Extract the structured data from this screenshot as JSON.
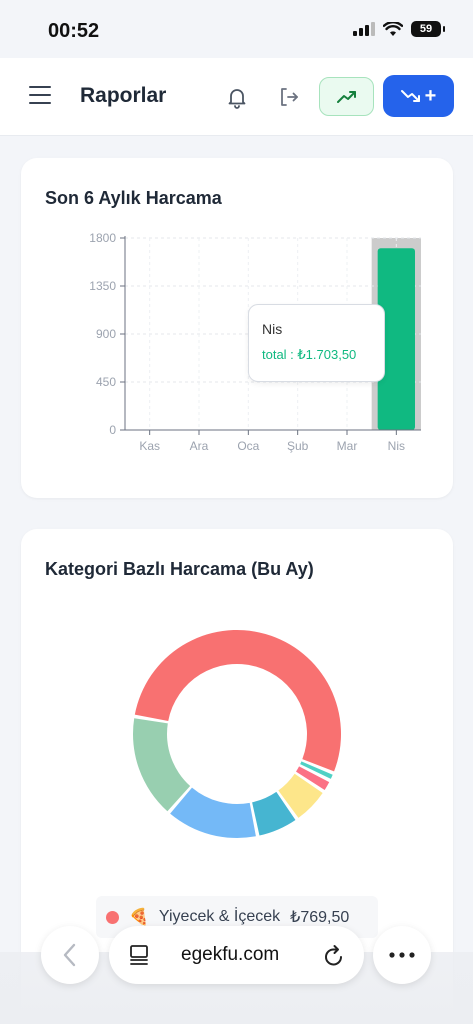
{
  "status_bar": {
    "time": "00:52",
    "battery": "59"
  },
  "header": {
    "title": "Raporlar"
  },
  "monthly_card": {
    "title": "Son 6 Aylık Harcama"
  },
  "tooltip": {
    "title": "Nis",
    "label": "total : ₺1.703,50"
  },
  "category_card": {
    "title": "Kategori Bazlı Harcama (Bu Ay)"
  },
  "legend": {
    "emoji": "🍕",
    "name": "Yiyecek & İçecek",
    "amount": "₺769,50",
    "color": "#f87171"
  },
  "browser": {
    "url": "egekfu.com"
  },
  "colors": {
    "accent": "#2563eb",
    "bar": "#10b981",
    "income_bg": "#eafaf0"
  },
  "chart_data": [
    {
      "type": "bar",
      "categories": [
        "Kas",
        "Ara",
        "Oca",
        "Şub",
        "Mar",
        "Nis"
      ],
      "values": [
        0,
        0,
        0,
        0,
        0,
        1703.5
      ],
      "ylim": [
        0,
        1800
      ],
      "yticks": [
        "0",
        "450",
        "900",
        "1350",
        "1800"
      ],
      "highlight": "Nis",
      "grid": true
    },
    {
      "type": "pie",
      "donut": true,
      "segments": [
        {
          "name": "Yiyecek & İçecek",
          "value": 769.5,
          "color": "#f87171"
        },
        {
          "value": 18,
          "color": "#4fd1c5"
        },
        {
          "value": 28,
          "color": "#fb7185"
        },
        {
          "value": 85,
          "color": "#fde68a"
        },
        {
          "value": 95,
          "color": "#46b5d1"
        },
        {
          "value": 210,
          "color": "#74b9f7"
        },
        {
          "value": 235,
          "color": "#98cfb0"
        }
      ]
    }
  ]
}
